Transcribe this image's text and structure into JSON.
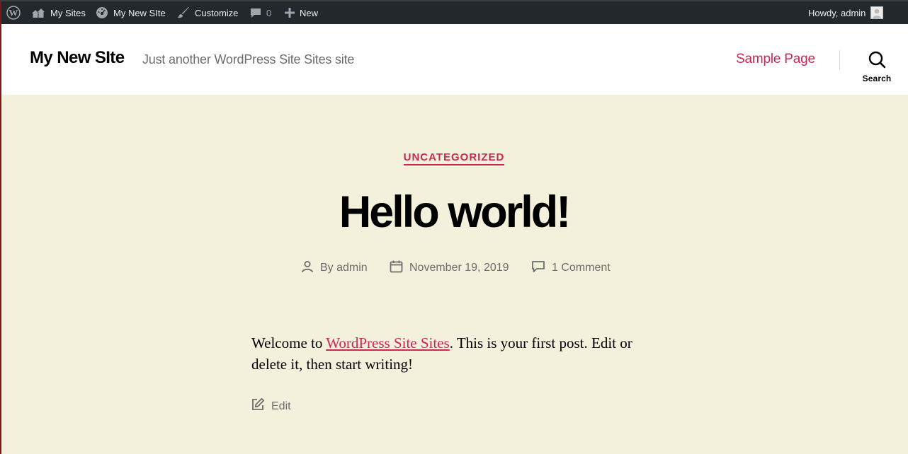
{
  "admin_bar": {
    "my_sites": "My Sites",
    "site_name": "My New SIte",
    "customize": "Customize",
    "comments_count": "0",
    "new": "New",
    "howdy": "Howdy, admin"
  },
  "header": {
    "site_title": "My New SIte",
    "site_description": "Just another WordPress Site Sites site",
    "nav_item": "Sample Page",
    "search_label": "Search"
  },
  "post": {
    "category": "UNCATEGORIZED",
    "title": "Hello world!",
    "author": "By admin",
    "date": "November 19, 2019",
    "comments": "1 Comment",
    "content_prefix": "Welcome to ",
    "content_link": "WordPress Site Sites",
    "content_suffix": ". This is your first post. Edit or delete it, then start writing!",
    "edit_label": "Edit"
  },
  "colors": {
    "accent": "#cd2653",
    "page_background": "#f3f0dc",
    "admin_bar": "#23282d"
  },
  "icons": [
    "wordpress-logo-icon",
    "my-sites-icon",
    "dashboard-icon",
    "brush-icon",
    "comment-bubble-icon",
    "plus-icon",
    "avatar-icon",
    "search-icon",
    "user-icon",
    "calendar-icon",
    "comment-icon",
    "edit-icon"
  ]
}
